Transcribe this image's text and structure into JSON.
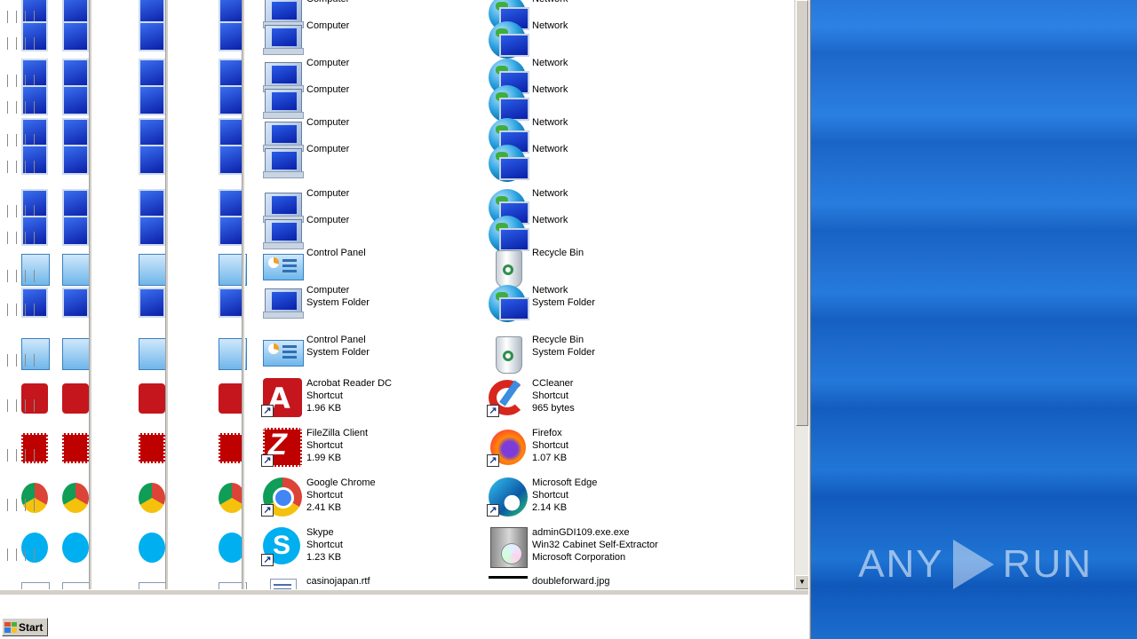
{
  "window": {
    "items": [
      {
        "name": "Computer",
        "icon": "computer-icon",
        "lines": [
          "Computer"
        ],
        "col": 0,
        "row": 0
      },
      {
        "name": "Network",
        "icon": "network-icon",
        "lines": [
          "Network"
        ],
        "col": 1,
        "row": 0
      },
      {
        "name": "Computer",
        "icon": "computer-icon",
        "lines": [
          "Computer"
        ],
        "col": 0,
        "row": 1
      },
      {
        "name": "Network",
        "icon": "network-icon",
        "lines": [
          "Network"
        ],
        "col": 1,
        "row": 1
      },
      {
        "name": "Computer",
        "icon": "computer-icon",
        "lines": [
          "Computer"
        ],
        "col": 0,
        "row": 2
      },
      {
        "name": "Network",
        "icon": "network-icon",
        "lines": [
          "Network"
        ],
        "col": 1,
        "row": 2
      },
      {
        "name": "Computer",
        "icon": "computer-icon",
        "lines": [
          "Computer"
        ],
        "col": 0,
        "row": 3
      },
      {
        "name": "Network",
        "icon": "network-icon",
        "lines": [
          "Network"
        ],
        "col": 1,
        "row": 3
      },
      {
        "name": "Computer",
        "icon": "computer-icon",
        "lines": [
          "Computer"
        ],
        "col": 0,
        "row": 4
      },
      {
        "name": "Network",
        "icon": "network-icon",
        "lines": [
          "Network"
        ],
        "col": 1,
        "row": 4
      },
      {
        "name": "Computer",
        "icon": "computer-icon",
        "lines": [
          "Computer"
        ],
        "col": 0,
        "row": 5
      },
      {
        "name": "Network",
        "icon": "network-icon",
        "lines": [
          "Network"
        ],
        "col": 1,
        "row": 5
      },
      {
        "name": "Computer",
        "icon": "computer-icon",
        "lines": [
          "Computer"
        ],
        "col": 0,
        "row": 6
      },
      {
        "name": "Network",
        "icon": "network-icon",
        "lines": [
          "Network"
        ],
        "col": 1,
        "row": 6
      },
      {
        "name": "Computer",
        "icon": "computer-icon",
        "lines": [
          "Computer"
        ],
        "col": 0,
        "row": 7
      },
      {
        "name": "Network",
        "icon": "network-icon",
        "lines": [
          "Network"
        ],
        "col": 1,
        "row": 7
      },
      {
        "name": "Control Panel",
        "icon": "control-panel-icon",
        "lines": [
          "Control Panel"
        ],
        "col": 0,
        "row": 8
      },
      {
        "name": "Recycle Bin",
        "icon": "recycle-bin-icon",
        "lines": [
          "Recycle Bin"
        ],
        "col": 1,
        "row": 8
      },
      {
        "name": "Computer",
        "icon": "computer-icon",
        "lines": [
          "Computer",
          "System Folder"
        ],
        "col": 0,
        "row": 9
      },
      {
        "name": "Network",
        "icon": "network-icon",
        "lines": [
          "Network",
          "System Folder"
        ],
        "col": 1,
        "row": 9
      },
      {
        "name": "Control Panel",
        "icon": "control-panel-icon",
        "lines": [
          "Control Panel",
          "System Folder"
        ],
        "col": 0,
        "row": 10
      },
      {
        "name": "Recycle Bin",
        "icon": "recycle-bin-icon",
        "lines": [
          "Recycle Bin",
          "System Folder"
        ],
        "col": 1,
        "row": 10
      },
      {
        "name": "Acrobat Reader DC",
        "icon": "acrobat-icon",
        "lines": [
          "Acrobat Reader DC",
          "Shortcut",
          "1.96 KB"
        ],
        "col": 0,
        "row": 11
      },
      {
        "name": "CCleaner",
        "icon": "ccleaner-icon",
        "lines": [
          "CCleaner",
          "Shortcut",
          "965 bytes"
        ],
        "col": 1,
        "row": 11
      },
      {
        "name": "FileZilla Client",
        "icon": "filezilla-icon",
        "lines": [
          "FileZilla Client",
          "Shortcut",
          "1.99 KB"
        ],
        "col": 0,
        "row": 12
      },
      {
        "name": "Firefox",
        "icon": "firefox-icon",
        "lines": [
          "Firefox",
          "Shortcut",
          "1.07 KB"
        ],
        "col": 1,
        "row": 12
      },
      {
        "name": "Google Chrome",
        "icon": "chrome-icon",
        "lines": [
          "Google Chrome",
          "Shortcut",
          "2.41 KB"
        ],
        "col": 0,
        "row": 13
      },
      {
        "name": "Microsoft Edge",
        "icon": "edge-icon",
        "lines": [
          "Microsoft Edge",
          "Shortcut",
          "2.14 KB"
        ],
        "col": 1,
        "row": 13
      },
      {
        "name": "Skype",
        "icon": "skype-icon",
        "lines": [
          "Skype",
          "Shortcut",
          "1.23 KB"
        ],
        "col": 0,
        "row": 14
      },
      {
        "name": "adminGDI109.exe.exe",
        "icon": "cabinet-icon",
        "lines": [
          "adminGDI109.exe.exe",
          "Win32 Cabinet Self-Extractor",
          "Microsoft Corporation"
        ],
        "col": 1,
        "row": 14
      },
      {
        "name": "casinojapan.rtf",
        "icon": "document-icon",
        "lines": [
          "casinojapan.rtf"
        ],
        "col": 0,
        "row": 15
      },
      {
        "name": "doubleforward.jpg",
        "icon": "image-icon",
        "lines": [
          "doubleforward.jpg"
        ],
        "col": 1,
        "row": 15
      }
    ]
  },
  "taskbar": {
    "start_label": "Start"
  },
  "watermark": {
    "text_left": "ANY",
    "text_right": "RUN"
  },
  "colors": {
    "desktop": "#1a6fd8",
    "chrome": "#d4d0c8",
    "selection": "#ffffff"
  }
}
